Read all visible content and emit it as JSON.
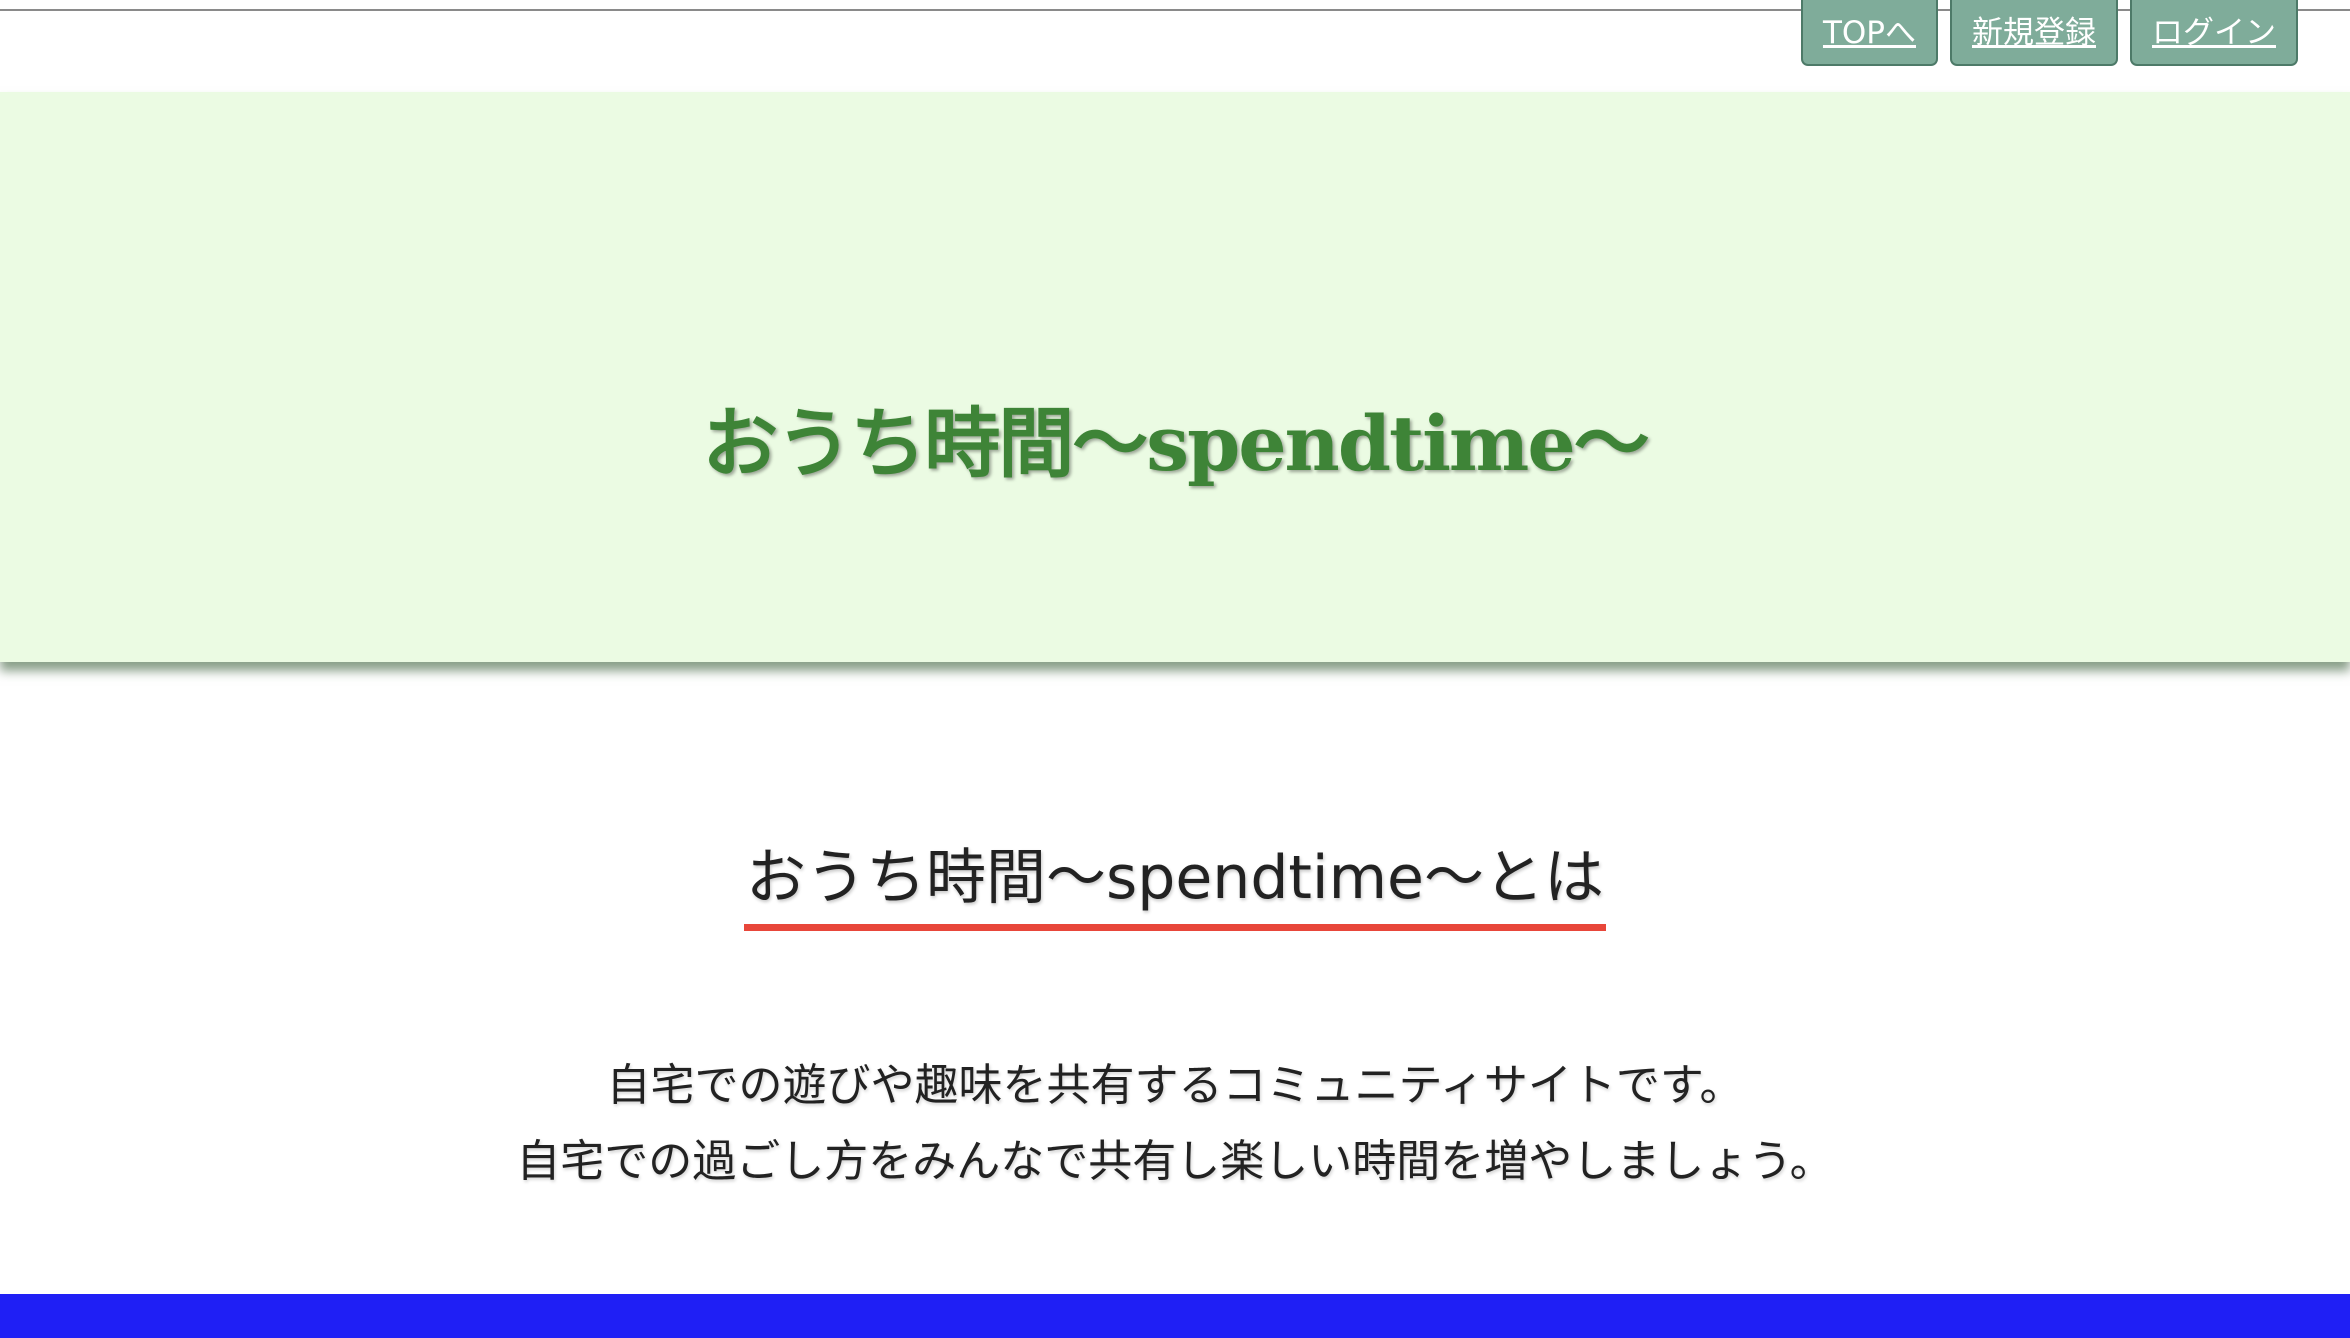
{
  "nav": {
    "top_label": "TOPへ",
    "signup_label": "新規登録",
    "login_label": "ログイン"
  },
  "hero": {
    "title": "おうち時間〜spendtime〜"
  },
  "about": {
    "heading": "おうち時間〜spendtime〜とは",
    "line1": "自宅での遊びや趣味を共有するコミュニティサイトです。",
    "line2": "自宅での過ごし方をみんなで共有し楽しい時間を増やしましょう。"
  },
  "colors": {
    "nav_button": "#7fac9a",
    "hero_background": "#ebfbe3",
    "hero_title": "#3e8437",
    "heading_underline": "#e8463a",
    "footer_bar": "#1f1ff5"
  }
}
